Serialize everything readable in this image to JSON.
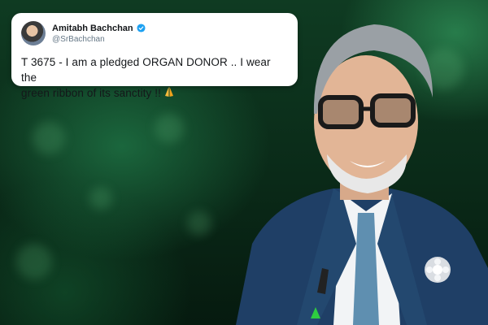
{
  "tweet": {
    "display_name": "Amitabh Bachchan",
    "handle": "@SrBachchan",
    "line1": "T 3675 - I am a pledged ORGAN DONOR  .. I wear the",
    "line2": "green ribbon of its sanctity  !!",
    "verified_icon": "verified-badge-icon",
    "emoji_icon": "folded-hands-icon"
  },
  "colors": {
    "background_green": "#0f3b22",
    "card": "#ffffff",
    "verified_blue": "#1da1f2",
    "handle_gray": "#657786",
    "suit": "#1f3f66",
    "tie": "#5f8fb0",
    "ribbon": "#2ecc40"
  }
}
